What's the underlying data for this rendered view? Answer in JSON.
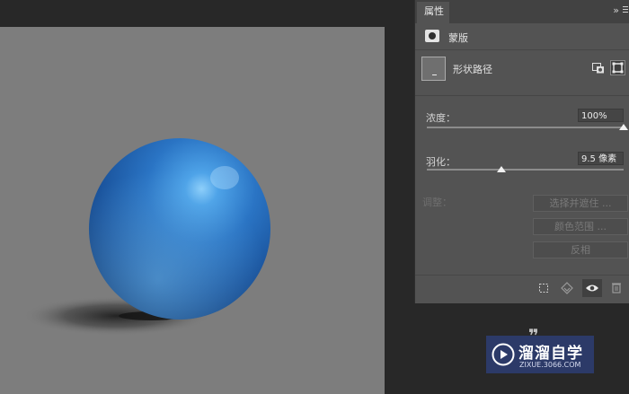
{
  "properties_panel": {
    "tab_label": "属性",
    "collapse_glyph": "»",
    "mask_label": "蒙版",
    "vector_mask_label": "形状路径",
    "density": {
      "label": "浓度：",
      "value": "100%",
      "level_percent": 100
    },
    "feather": {
      "label": "羽化：",
      "value": "9.5 像素",
      "level_fraction": 0.38
    },
    "adjust": {
      "label": "调整：",
      "buttons": [
        "选择并遮住 ...",
        "颜色范围 ...",
        "反相"
      ]
    },
    "footer_icons": [
      "load-selection-icon",
      "apply-mask-icon",
      "eye-icon",
      "trash-icon"
    ]
  },
  "canvas": {
    "background": "#7d7d7d",
    "sphere_color": "#1f5aa6",
    "highlight_color": "#7fc3f6"
  },
  "watermark": {
    "brand": "溜溜自学",
    "url": "ZIXUE.3066.COM",
    "accent": "#2d3c6e"
  }
}
